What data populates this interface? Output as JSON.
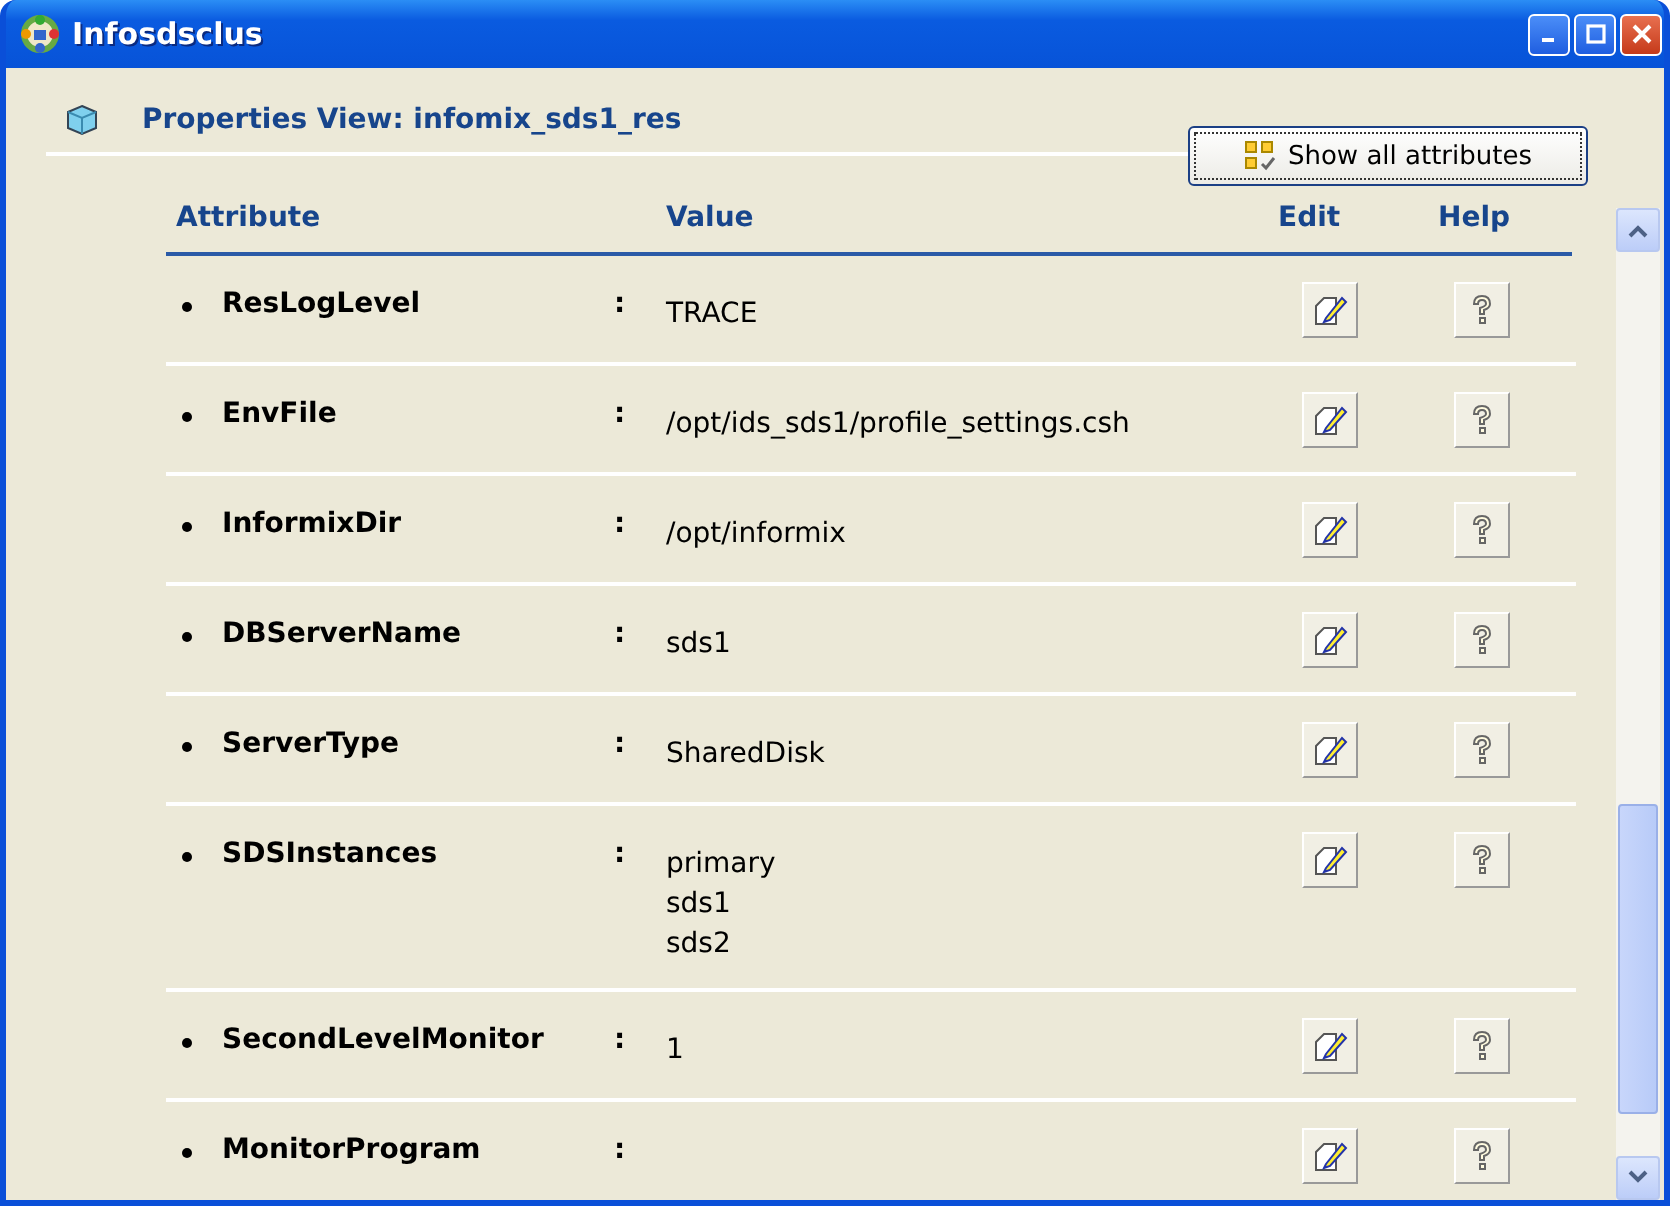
{
  "window": {
    "title": "Infosdsclus"
  },
  "header": {
    "title": "Properties View:  infomix_sds1_res",
    "button": "Show all attributes"
  },
  "table": {
    "columns": [
      "Attribute",
      "Value",
      "Edit",
      "Help"
    ],
    "rows": [
      {
        "name": "ResLogLevel",
        "separator": ":",
        "value": [
          "TRACE"
        ]
      },
      {
        "name": "EnvFile",
        "separator": ":",
        "value": [
          "/opt/ids_sds1/profile_settings.csh"
        ]
      },
      {
        "name": "InformixDir",
        "separator": ":",
        "value": [
          "/opt/informix"
        ]
      },
      {
        "name": "DBServerName",
        "separator": ":",
        "value": [
          "sds1"
        ]
      },
      {
        "name": "ServerType",
        "separator": ":",
        "value": [
          "SharedDisk"
        ]
      },
      {
        "name": "SDSInstances",
        "separator": ":",
        "value": [
          "primary",
          "sds1",
          "sds2"
        ]
      },
      {
        "name": "SecondLevelMonitor",
        "separator": ":",
        "value": [
          "1"
        ]
      },
      {
        "name": "MonitorProgram",
        "separator": ":",
        "value": []
      }
    ]
  }
}
